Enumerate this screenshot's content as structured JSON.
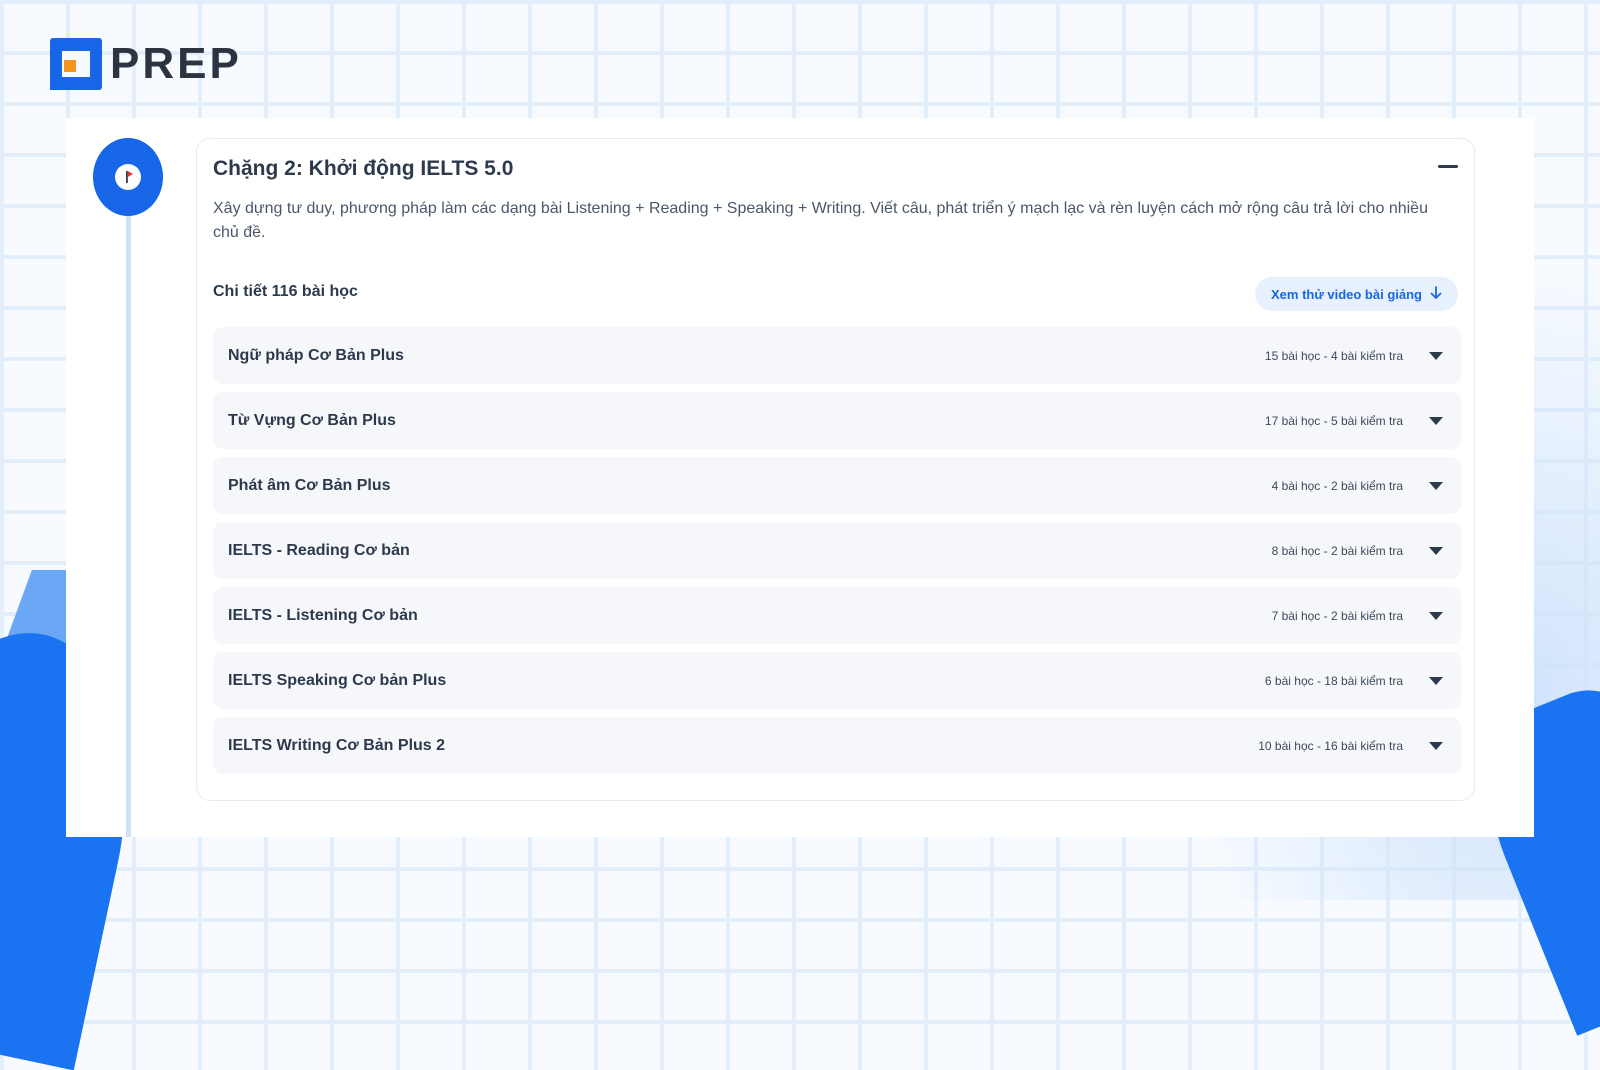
{
  "brand": {
    "name": "PREP"
  },
  "colors": {
    "primary": "#1766e8",
    "accent": "#f7941d",
    "text": "#2c3a4b",
    "chip_bg": "#e6f1fd"
  },
  "stage": {
    "title": "Chặng 2: Khởi động IELTS 5.0",
    "description": "Xây dựng tư duy, phương pháp làm các dạng bài Listening + Reading + Speaking + Writing. Viết câu, phát triển ý mạch lạc và rèn luyện cách mở rộng câu trả lời cho nhiều chủ đề.",
    "detail_label": "Chi tiết 116 bài học",
    "preview_button": "Xem thử video bài giảng",
    "icons": {
      "timeline": "flag-icon",
      "collapse": "minus-icon",
      "preview": "arrow-down-icon",
      "expand": "caret-down-icon"
    }
  },
  "modules": [
    {
      "name": "Ngữ pháp Cơ Bản Plus",
      "meta": "15 bài học - 4 bài kiểm tra"
    },
    {
      "name": "Từ Vựng Cơ Bản Plus",
      "meta": "17 bài học - 5 bài kiểm tra"
    },
    {
      "name": "Phát âm Cơ Bản Plus",
      "meta": "4 bài học - 2 bài kiểm tra"
    },
    {
      "name": "IELTS - Reading Cơ bản",
      "meta": "8 bài học - 2 bài kiểm tra"
    },
    {
      "name": "IELTS - Listening Cơ bản",
      "meta": "7 bài học - 2 bài kiểm tra"
    },
    {
      "name": "IELTS Speaking Cơ bản Plus",
      "meta": "6 bài học - 18 bài kiểm tra"
    },
    {
      "name": "IELTS Writing Cơ Bản Plus 2",
      "meta": "10 bài học - 16 bài kiểm tra"
    }
  ]
}
